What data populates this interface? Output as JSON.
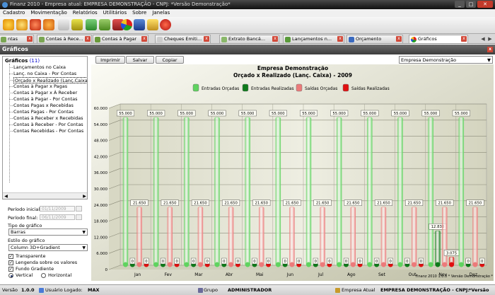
{
  "window": {
    "title": "Finanz 2010 - Empresa atual: EMPRESA DEMONSTRAÇÃO - CNPJ:  *Versão Demonstração*"
  },
  "menu": [
    "Cadastro",
    "Movimentação",
    "Relatórios",
    "Utilitários",
    "Sobre",
    "Janelas"
  ],
  "tabs": [
    {
      "label": "ntas",
      "icon": "accounts-icon",
      "active": false
    },
    {
      "label": "Contas à Rece...",
      "icon": "receivable-icon",
      "active": false
    },
    {
      "label": "Contas à Pagar",
      "icon": "payable-icon",
      "active": false
    },
    {
      "label": "Cheques Emiti...",
      "icon": "cheque-icon",
      "active": false
    },
    {
      "label": "Extrato Bancá...",
      "icon": "bank-statement-icon",
      "active": false
    },
    {
      "label": "Lançamentos n...",
      "icon": "entries-icon",
      "active": false
    },
    {
      "label": "Orçamento",
      "icon": "budget-icon",
      "active": false
    },
    {
      "label": "Gráficos",
      "icon": "chart-icon",
      "active": true
    }
  ],
  "panel": {
    "title": "Gráficos"
  },
  "tree": {
    "root": "Gráficos",
    "count": "(11)",
    "items": [
      "Lançamentos no Caixa",
      "Lanç. no Caixa - Por Contas",
      "Orçado x Realizado (Lanç.Caixa)",
      "Contas à Pagar x Pagas",
      "Contas à Pagar x À Receber",
      "Contas à Pagar - Por Contas",
      "Contas Pagas x Recebidas",
      "Contas Pagas - Por Contas",
      "Contas à Receber x Recebidas",
      "Contas à Receber - Por Contas",
      "Contas Recebidas - Por Contas"
    ],
    "selected_index": 2
  },
  "options": {
    "period_start_label": "Período inicial:",
    "period_start": "01/11/2009",
    "period_end_label": "Período final:",
    "period_end": "06/11/2009",
    "chart_type_label": "Tipo de gráfico",
    "chart_type": "Barras",
    "chart_style_label": "Estilo do gráfico",
    "chart_style": "Column 3D+Gradient",
    "transparent_label": "Transparente",
    "legend_label": "Lengenda sobre os valores",
    "gradient_label": "Fundo Gradiente",
    "vertical_label": "Vertical",
    "horizontal_label": "Horizontal"
  },
  "buttons": {
    "print": "Imprimir",
    "save": "Salvar",
    "copy": "Copiar"
  },
  "company_select": "Empresa Demonstração",
  "chart_data": {
    "type": "bar",
    "title": "Empresa Demonstração",
    "subtitle": "Orçado x Realizado (Lanç. Caixa) - 2009",
    "categories": [
      "Jan",
      "Fev",
      "Mar",
      "Abr",
      "Mai",
      "Jun",
      "Jul",
      "Ago",
      "Set",
      "Out",
      "Nov",
      "Dez"
    ],
    "series": [
      {
        "name": "Entradas Orçadas",
        "color": "#5fd35f",
        "values": [
          55000,
          55000,
          55000,
          55000,
          55000,
          55000,
          55000,
          55000,
          55000,
          55000,
          55000,
          55000
        ]
      },
      {
        "name": "Entradas Realizadas",
        "color": "#0e7a1a",
        "values": [
          0,
          0,
          0,
          0,
          0,
          0,
          0,
          0,
          0,
          0,
          12830,
          0
        ]
      },
      {
        "name": "Saídas Orçadas",
        "color": "#ec7a7a",
        "values": [
          21650,
          21650,
          21650,
          21650,
          21650,
          21650,
          21650,
          21650,
          21650,
          21650,
          21650,
          21650
        ]
      },
      {
        "name": "Saídas Realizadas",
        "color": "#e01010",
        "values": [
          0,
          0,
          0,
          0,
          0,
          0,
          0,
          0,
          0,
          0,
          3075,
          0
        ]
      }
    ],
    "data_labels": [
      "55.000",
      "0",
      "21.650",
      "0"
    ],
    "nov_labels": [
      "55.000",
      "12.830",
      "21.650",
      "3.075"
    ],
    "yticks": [
      "0",
      "6.000",
      "12.000",
      "18.000",
      "24.000",
      "30.000",
      "36.000",
      "42.000",
      "48.000",
      "54.000",
      "60.000"
    ],
    "ylim": [
      0,
      60000
    ],
    "grid": true,
    "legend": "top",
    "footer": "Finanz 2010   1.0.0   * Versão Demonstração *"
  },
  "status": {
    "version_label": "Versão",
    "version": "1.0.0",
    "user_label": "Usuário Logado:",
    "user": "MAX",
    "group_label": "Grupo",
    "group": "ADMINISTRADOR",
    "company_label": "Empresa Atual",
    "company": "EMPRESA DEMONSTRAÇÃO - CNPJ:",
    "version_tag": "*Versão"
  }
}
